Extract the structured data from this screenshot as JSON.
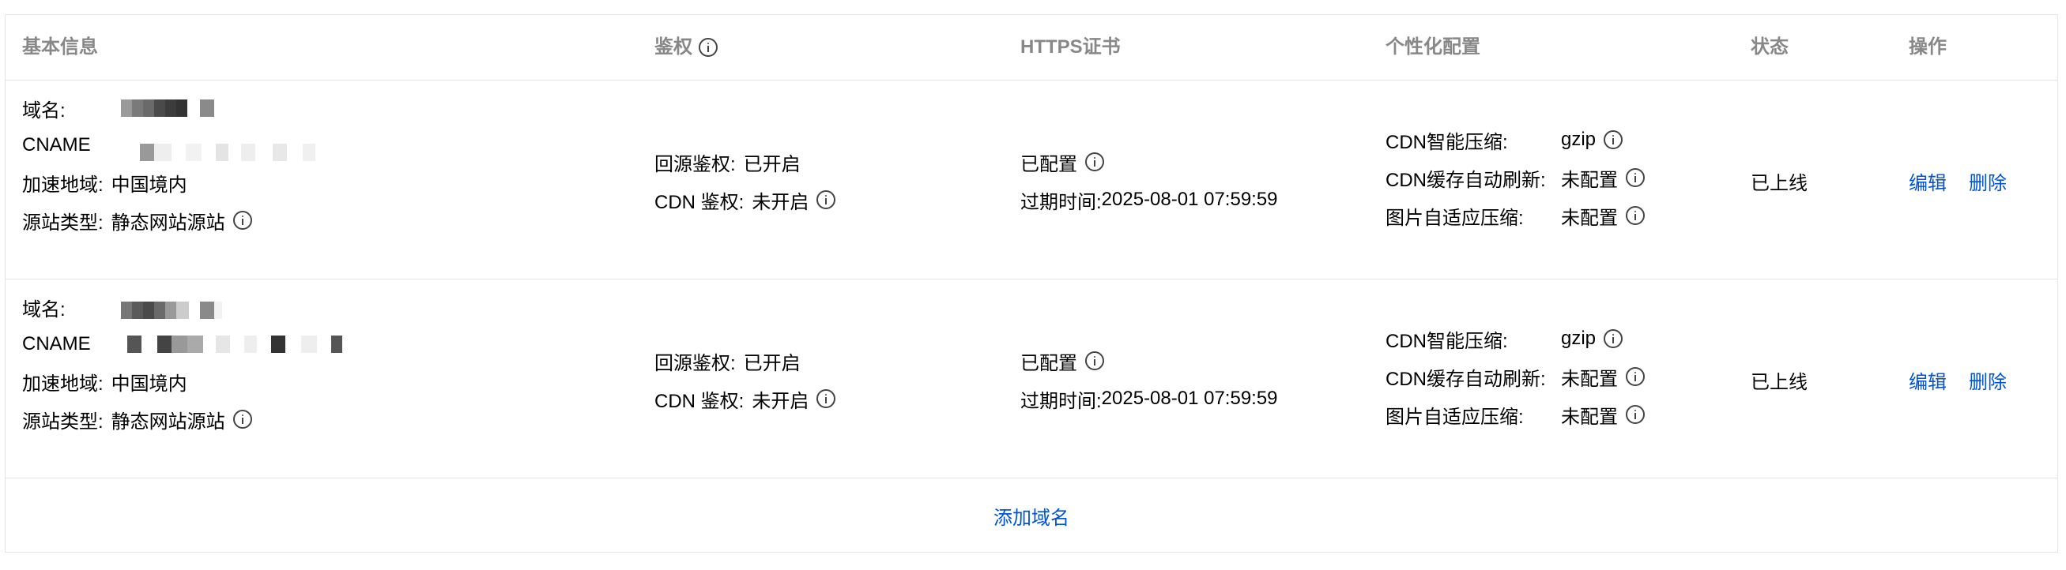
{
  "header": {
    "basic_info": "基本信息",
    "auth": "鉴权",
    "https": "HTTPS证书",
    "custom": "个性化配置",
    "status": "状态",
    "ops": "操作"
  },
  "rows": [
    {
      "domain_label": "域名:",
      "cname_label": "CNAME",
      "region_label": "加速地域:",
      "region_value": "中国境内",
      "origin_label": "源站类型:",
      "origin_value": "静态网站源站",
      "back_auth_label": "回源鉴权:",
      "back_auth_value": "已开启",
      "cdn_auth_label": "CDN 鉴权:",
      "cdn_auth_value": "未开启",
      "https_value": "已配置",
      "expire_label": "过期时间:",
      "expire_value": "2025-08-01 07:59:59",
      "compress_label": "CDN智能压缩:",
      "compress_value": "gzip",
      "refresh_label": "CDN缓存自动刷新:",
      "refresh_value": "未配置",
      "image_label": "图片自适应压缩:",
      "image_value": "未配置",
      "status": "已上线",
      "edit": "编辑",
      "delete": "删除"
    },
    {
      "domain_label": "域名:",
      "cname_label": "CNAME",
      "region_label": "加速地域:",
      "region_value": "中国境内",
      "origin_label": "源站类型:",
      "origin_value": "静态网站源站",
      "back_auth_label": "回源鉴权:",
      "back_auth_value": "已开启",
      "cdn_auth_label": "CDN 鉴权:",
      "cdn_auth_value": "未开启",
      "https_value": "已配置",
      "expire_label": "过期时间:",
      "expire_value": "2025-08-01 07:59:59",
      "compress_label": "CDN智能压缩:",
      "compress_value": "gzip",
      "refresh_label": "CDN缓存自动刷新:",
      "refresh_value": "未配置",
      "image_label": "图片自适应压缩:",
      "image_value": "未配置",
      "status": "已上线",
      "edit": "编辑",
      "delete": "删除"
    }
  ],
  "add_domain": "添加域名",
  "colors": {
    "link": "#0052d9",
    "header_text": "#888888",
    "border": "#e5e5e5"
  }
}
